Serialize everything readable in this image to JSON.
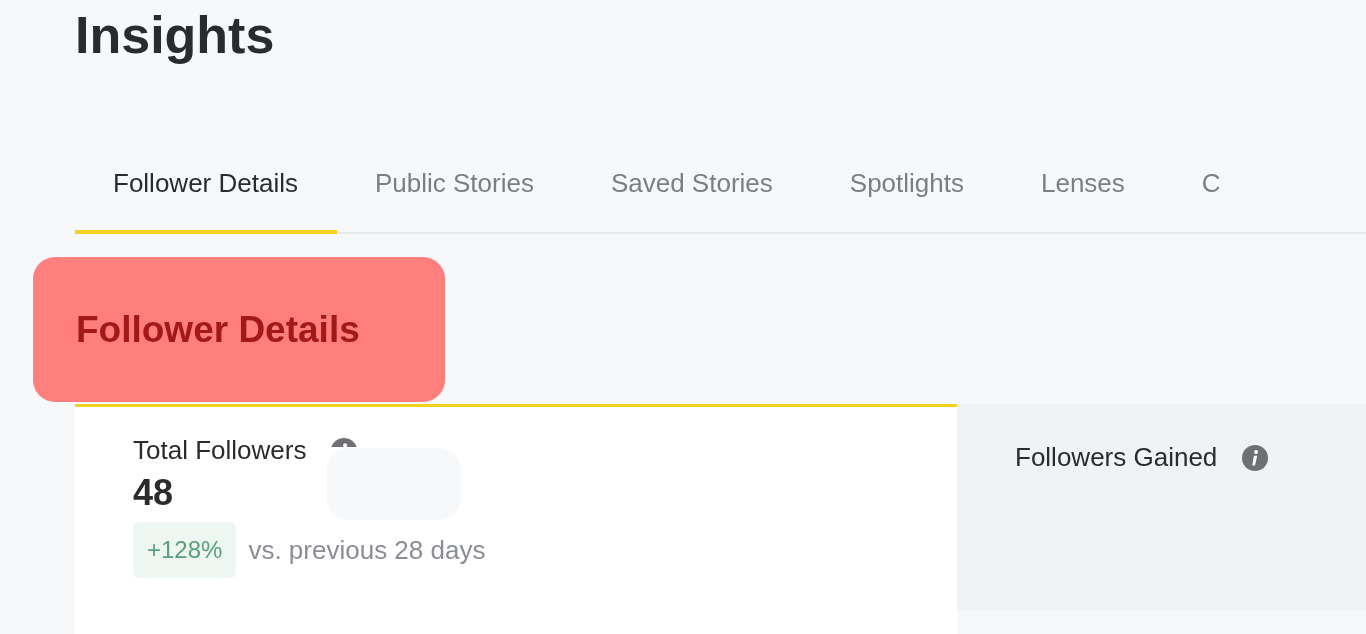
{
  "page": {
    "title": "Insights"
  },
  "tabs": [
    {
      "label": "Follower Details",
      "selected": true
    },
    {
      "label": "Public Stories",
      "selected": false
    },
    {
      "label": "Saved Stories",
      "selected": false
    },
    {
      "label": "Spotlights",
      "selected": false
    },
    {
      "label": "Lenses",
      "selected": false
    },
    {
      "label": "C",
      "selected": false
    }
  ],
  "section": {
    "heading": "Follower Details"
  },
  "cards": [
    {
      "title": "Total Followers",
      "selected": true,
      "value": "48",
      "change": "+128%",
      "comparison": "vs. previous 28 days"
    },
    {
      "title": "Followers Gained",
      "selected": false
    }
  ]
}
